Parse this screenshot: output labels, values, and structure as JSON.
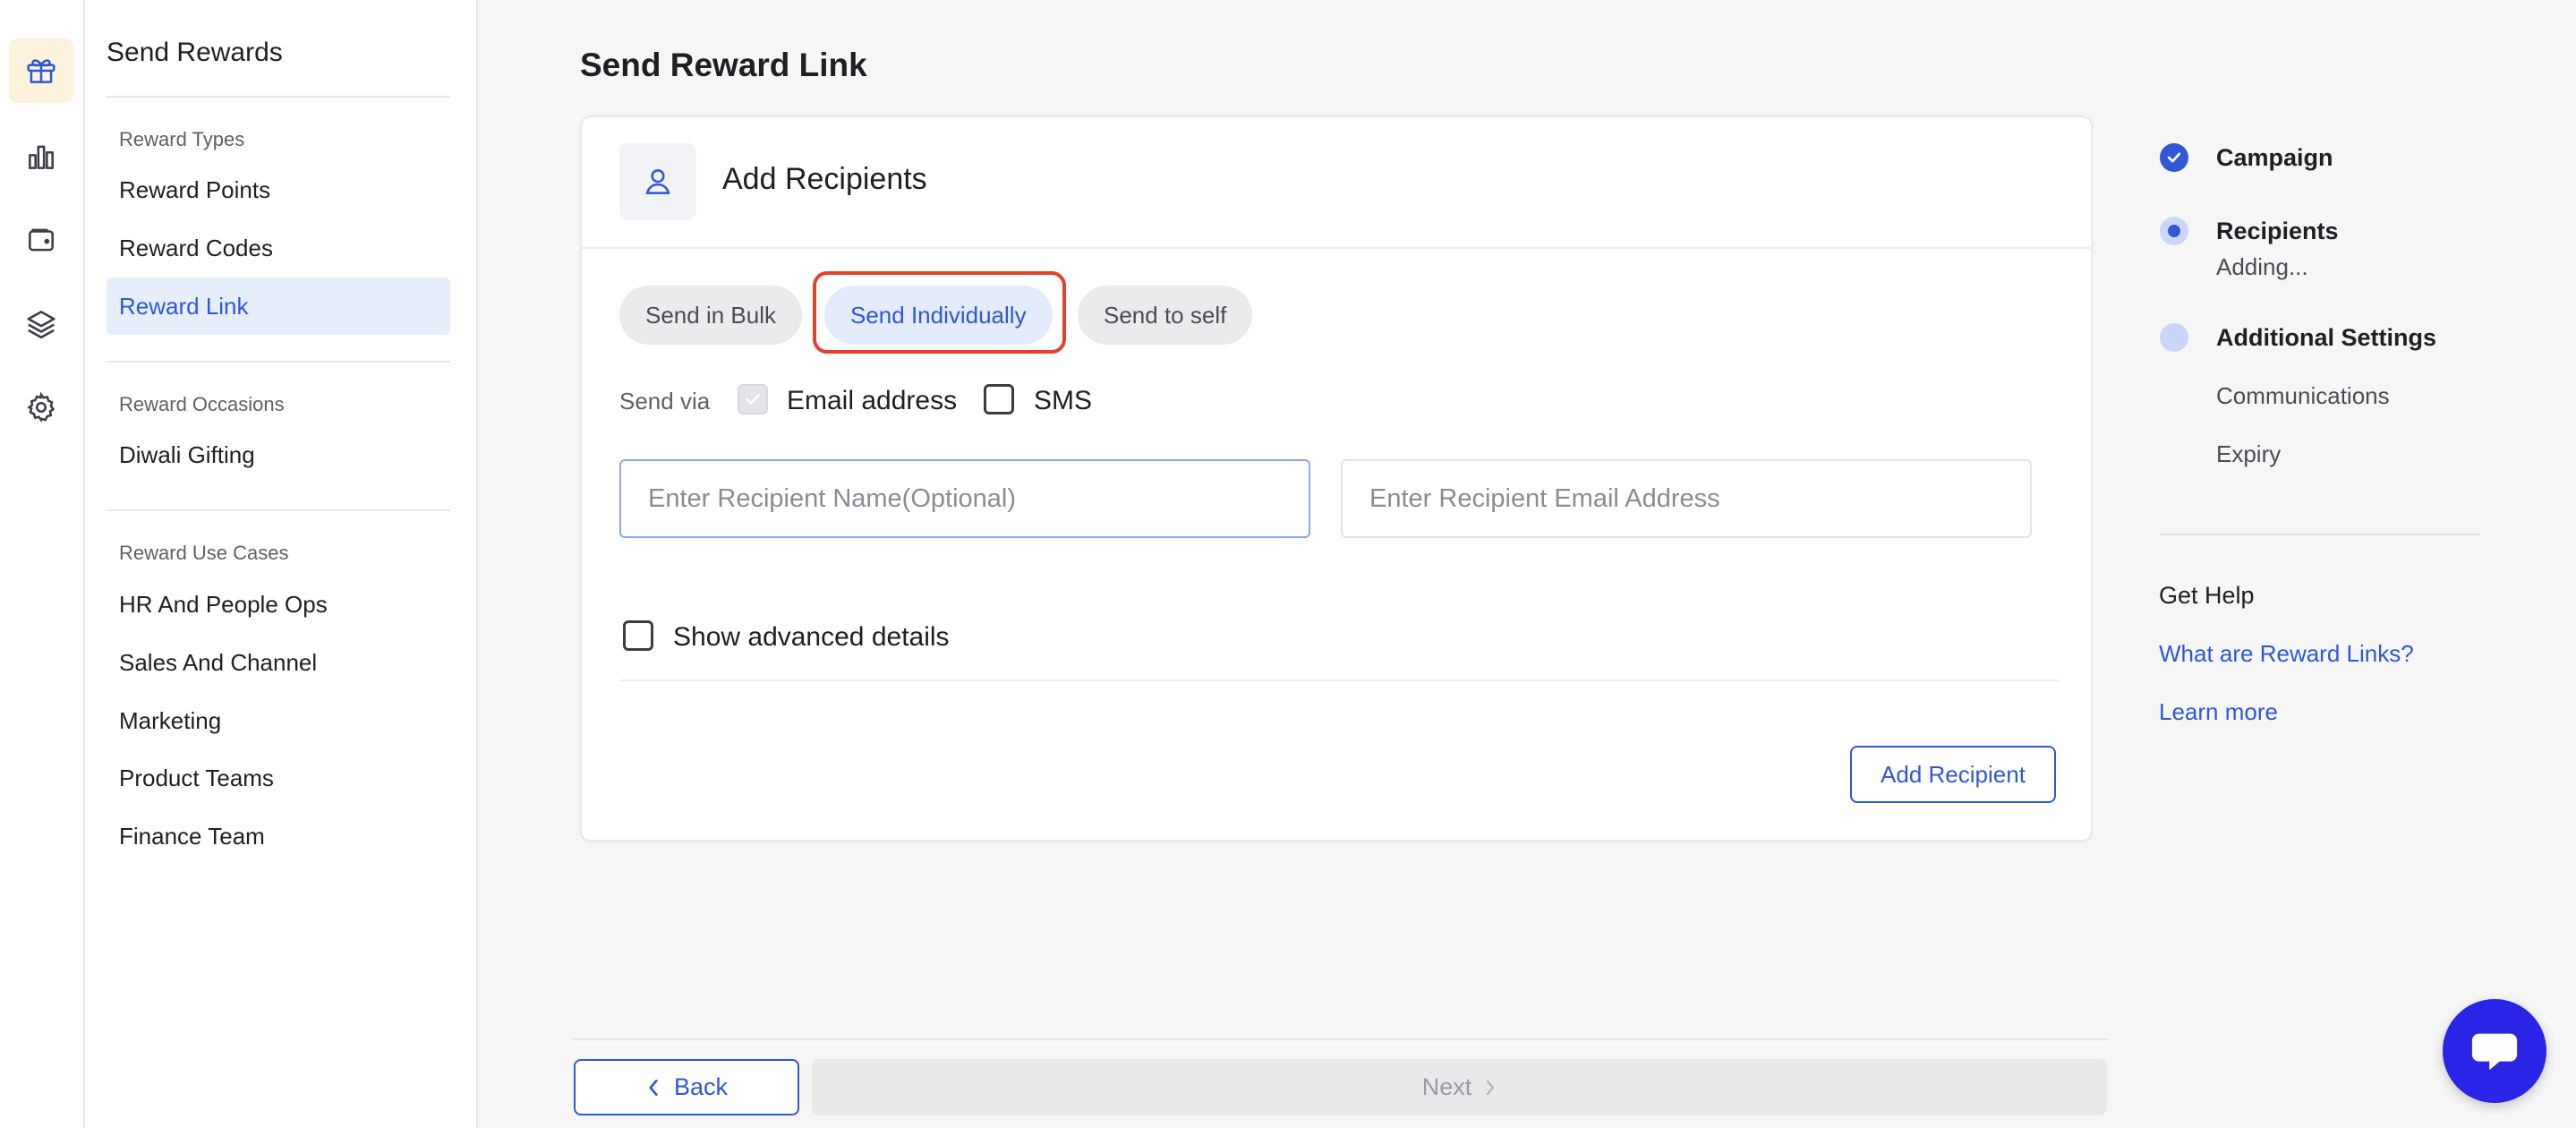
{
  "nav": {
    "title": "Send Rewards",
    "sections": [
      {
        "heading": "Reward Types",
        "items": [
          "Reward Points",
          "Reward Codes",
          "Reward Link"
        ]
      },
      {
        "heading": "Reward Occasions",
        "items": [
          "Diwali Gifting"
        ]
      },
      {
        "heading": "Reward Use Cases",
        "items": [
          "HR And People Ops",
          "Sales And Channel",
          "Marketing",
          "Product Teams",
          "Finance Team"
        ]
      }
    ],
    "active_item": "Reward Link"
  },
  "rail": {
    "icons": [
      "gift-icon",
      "bar-chart-icon",
      "wallet-icon",
      "layers-icon",
      "settings-icon"
    ],
    "active": "gift-icon"
  },
  "main": {
    "title": "Send Reward Link",
    "card": {
      "title": "Add Recipients",
      "icon": "user-icon",
      "tabs": [
        "Send in Bulk",
        "Send Individually",
        "Send to self"
      ],
      "active_tab": "Send Individually",
      "send_via": {
        "label": "Send via",
        "options": [
          {
            "label": "Email address",
            "checked": true,
            "disabled": true
          },
          {
            "label": "SMS",
            "checked": false
          }
        ]
      },
      "inputs": {
        "name_placeholder": "Enter Recipient Name(Optional)",
        "email_placeholder": "Enter Recipient Email Address",
        "name_value": "",
        "email_value": ""
      },
      "advanced_label": "Show advanced details",
      "add_button": "Add Recipient"
    },
    "footer": {
      "back": "Back",
      "next": "Next"
    }
  },
  "stepper": {
    "steps": [
      {
        "label": "Campaign",
        "state": "done"
      },
      {
        "label": "Recipients",
        "state": "current",
        "sub": "Adding..."
      },
      {
        "label": "Additional Settings",
        "state": "pending",
        "subs": [
          "Communications",
          "Expiry"
        ]
      }
    ]
  },
  "help": {
    "title": "Get Help",
    "links": [
      "What are Reward Links?",
      "Learn more"
    ]
  },
  "colors": {
    "accent": "#2f57d6",
    "highlight": "#e3412b",
    "chat": "#2a24e6",
    "active_rail": "#fdf3dc"
  }
}
